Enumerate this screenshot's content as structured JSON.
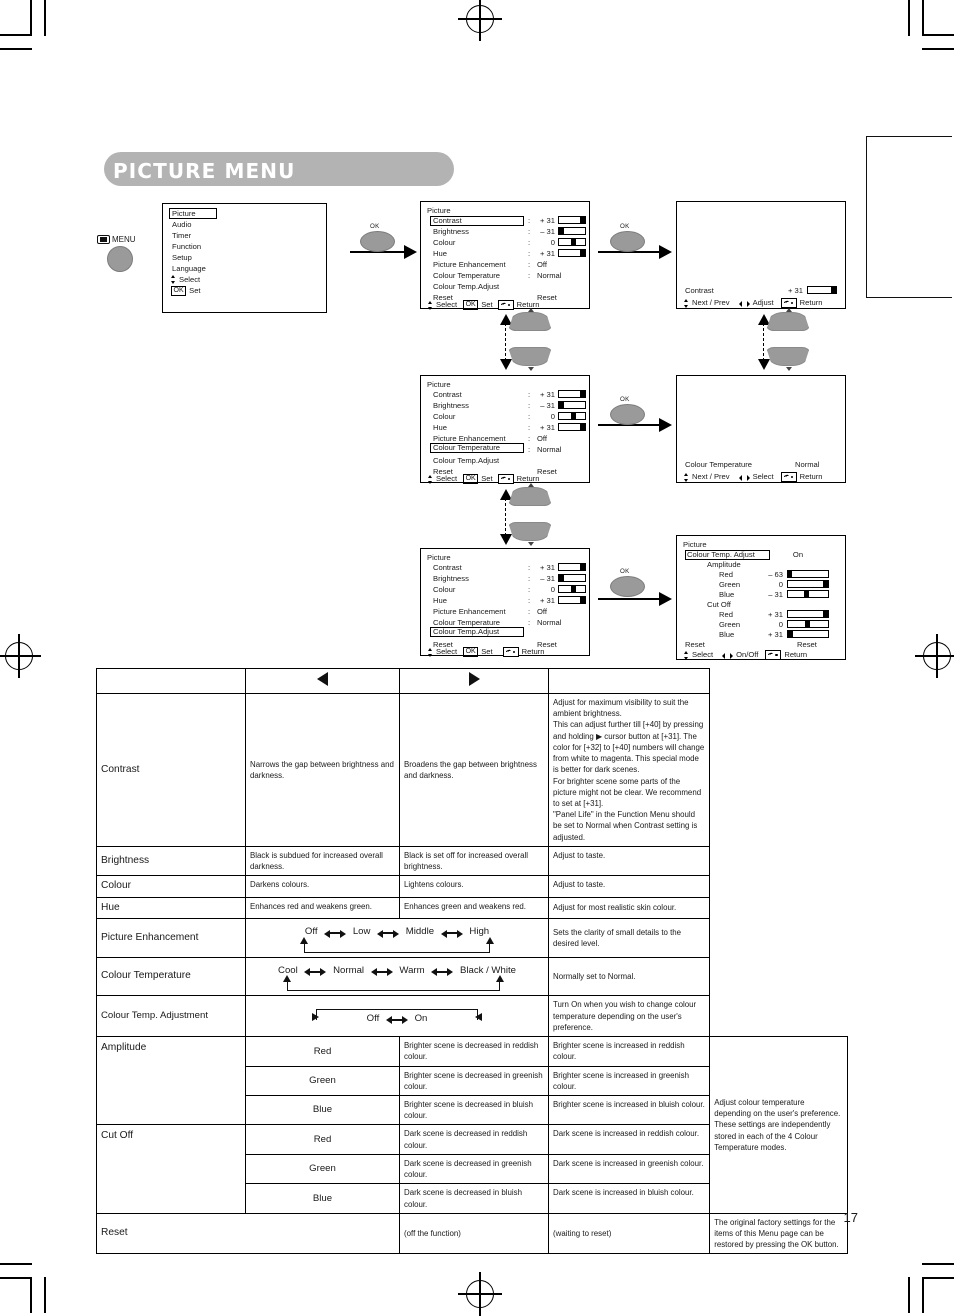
{
  "page": {
    "number": "17",
    "title": "PICTURE MENU"
  },
  "remote": {
    "menu_label": "MENU",
    "ok_label": "OK"
  },
  "osd": {
    "main_menu": {
      "items": [
        "Picture",
        "Audio",
        "Timer",
        "Function",
        "Setup",
        "Language"
      ],
      "selected": "Picture",
      "footer_select": "Select",
      "footer_ok": "OK",
      "footer_set": "Set"
    },
    "picture_menu": {
      "title": "Picture",
      "rows": [
        {
          "label": "Contrast",
          "colon": ":",
          "value": "+ 31",
          "bar": "right"
        },
        {
          "label": "Brightness",
          "colon": ":",
          "value": "– 31",
          "bar": "left"
        },
        {
          "label": "Colour",
          "colon": ":",
          "value": "0",
          "bar": "center"
        },
        {
          "label": "Hue",
          "colon": ":",
          "value": "+ 31",
          "bar": "right"
        },
        {
          "label": "Picture Enhancement",
          "colon": ":",
          "value": "Off",
          "bar": "none"
        },
        {
          "label": "Colour Temperature",
          "colon": ":",
          "value": "Normal",
          "bar": "none"
        },
        {
          "label": "Colour Temp.Adjust",
          "colon": "",
          "value": "",
          "bar": "none"
        },
        {
          "label": "Reset",
          "colon": "",
          "value": "Reset",
          "bar": "none"
        }
      ],
      "footer": {
        "select": "Select",
        "ok": "OK",
        "set": "Set",
        "return": "Return"
      },
      "highlight_1": "Contrast",
      "highlight_2": "Colour Temperature",
      "highlight_3": "Colour Temp.Adjust"
    },
    "contrast_bar_panel": {
      "label": "Contrast",
      "value": "+ 31",
      "footer": {
        "nextprev": "Next / Prev",
        "adjust": "Adjust",
        "return": "Return"
      }
    },
    "colour_temp_panel": {
      "label": "Colour Temperature",
      "value": "Normal",
      "footer": {
        "nextprev": "Next / Prev",
        "select": "Select",
        "return": "Return"
      }
    },
    "colour_temp_adjust_panel": {
      "title": "Picture",
      "header_label": "Colour Temp. Adjust",
      "header_value": "On",
      "group_amplitude": "Amplitude",
      "group_cutoff": "Cut Off",
      "rows": [
        {
          "label": "Red",
          "value": "– 63",
          "bar": "farleft"
        },
        {
          "label": "Green",
          "value": "0",
          "bar": "right"
        },
        {
          "label": "Blue",
          "value": "– 31",
          "bar": "center"
        },
        {
          "label": "Red",
          "value": "+ 31",
          "bar": "right"
        },
        {
          "label": "Green",
          "value": "0",
          "bar": "center"
        },
        {
          "label": "Blue",
          "value": "+ 31",
          "bar": "left"
        }
      ],
      "reset_label": "Reset",
      "reset_value": "Reset",
      "footer": {
        "select": "Select",
        "onoff": "On/Off",
        "return": "Return"
      }
    }
  },
  "table": {
    "header": {
      "col1": "",
      "col2": "left-arrow",
      "col3": "right-arrow",
      "col4": ""
    },
    "rows": [
      {
        "name": "Contrast",
        "left": "Narrows the gap between brightness and darkness.",
        "right": "Broadens the gap between brightness and darkness.",
        "desc": "Adjust for maximum visibility to suit the ambient brightness.\nThis can adjust further till [+40] by pressing and holding ▶ cursor button at [+31]. The color for [+32] to [+40] numbers will change from white to magenta. This special mode is better for dark scenes.\nFor brighter scene some parts of the picture might not be clear. We recommend to set at [+31].\n\"Panel Life\" in the Function Menu should be set to Normal when Contrast setting is adjusted."
      },
      {
        "name": "Brightness",
        "left": "Black is subdued for increased overall darkness.",
        "right": "Black is set off for increased overall brightness.",
        "desc": "Adjust to taste."
      },
      {
        "name": "Colour",
        "left": "Darkens colours.",
        "right": "Lightens colours.",
        "desc": "Adjust to taste."
      },
      {
        "name": "Hue",
        "left": "Enhances red and weakens green.",
        "right": "Enhances green and weakens red.",
        "desc": "Adjust for most realistic skin colour."
      }
    ],
    "picture_enhancement": {
      "name": "Picture Enhancement",
      "chain": [
        "Off",
        "Low",
        "Middle",
        "High"
      ],
      "desc": "Sets the clarity of small details to the desired level."
    },
    "colour_temperature": {
      "name": "Colour Temperature",
      "chain": [
        "Cool",
        "Normal",
        "Warm",
        "Black / White"
      ],
      "desc": "Normally set to Normal."
    },
    "colour_temp_adjustment": {
      "name": "Colour Temp. Adjustment",
      "chain": [
        "Off",
        "On"
      ],
      "desc": "Turn On when you wish to change colour temperature depending on the user's preference."
    },
    "amplitude": {
      "group": "Amplitude",
      "rows": [
        {
          "name": "Red",
          "left": "Brighter scene is decreased in reddish colour.",
          "right": "Brighter scene is increased in reddish colour."
        },
        {
          "name": "Green",
          "left": "Brighter scene is decreased in greenish colour.",
          "right": "Brighter scene is increased in greenish colour."
        },
        {
          "name": "Blue",
          "left": "Brighter scene is decreased in bluish colour.",
          "right": "Brighter scene is increased in bluish colour."
        }
      ]
    },
    "cutoff": {
      "group": "Cut Off",
      "rows": [
        {
          "name": "Red",
          "left": "Dark scene is decreased in reddish colour.",
          "right": "Dark scene is increased in reddish colour."
        },
        {
          "name": "Green",
          "left": "Dark scene is decreased in greenish colour.",
          "right": "Dark scene is increased in greenish colour."
        },
        {
          "name": "Blue",
          "left": "Dark scene is decreased in bluish colour.",
          "right": "Dark scene is increased in bluish colour."
        }
      ],
      "desc": "Adjust colour temperature depending on the user's preference. These settings are independently stored in each of the 4 Colour Temperature modes."
    },
    "reset": {
      "name": "Reset",
      "left": "(off the function)",
      "right": "(waiting to reset)",
      "desc": "The original factory settings for the items of this Menu page can be restored by pressing the OK button."
    }
  }
}
